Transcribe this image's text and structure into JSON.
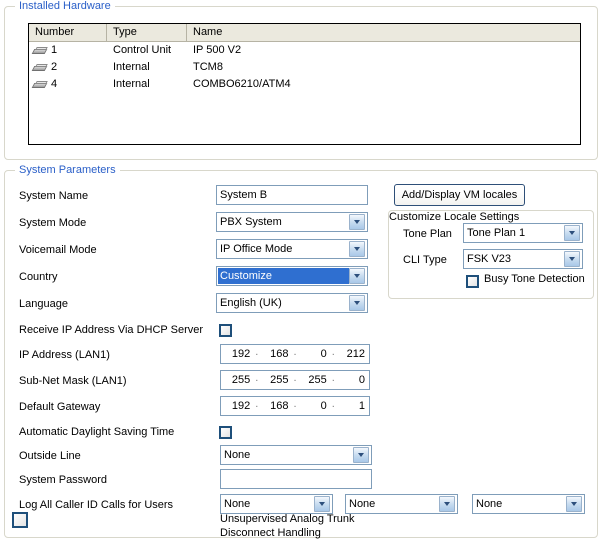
{
  "hardware": {
    "group_title": "Installed Hardware",
    "columns": [
      "Number",
      "Type",
      "Name"
    ],
    "rows": [
      {
        "number": "1",
        "type": "Control Unit",
        "name": "IP 500 V2",
        "icon": "hardware-module-icon"
      },
      {
        "number": "2",
        "type": "Internal",
        "name": "TCM8",
        "icon": "hardware-module-icon"
      },
      {
        "number": "4",
        "type": "Internal",
        "name": "COMBO6210/ATM4",
        "icon": "hardware-module-icon"
      }
    ]
  },
  "params": {
    "group_title": "System Parameters",
    "system_name": {
      "label": "System Name",
      "value": "System B"
    },
    "system_mode": {
      "label": "System Mode",
      "value": "PBX System"
    },
    "voicemail_mode": {
      "label": "Voicemail Mode",
      "value": "IP Office Mode"
    },
    "country": {
      "label": "Country",
      "value": "Customize"
    },
    "language": {
      "label": "Language",
      "value": "English (UK)"
    },
    "dhcp": {
      "label": "Receive IP Address Via DHCP Server",
      "checked": false
    },
    "ip_address": {
      "label": "IP Address (LAN1)",
      "octets": [
        "192",
        "168",
        "0",
        "212"
      ]
    },
    "subnet_mask": {
      "label": "Sub-Net Mask (LAN1)",
      "octets": [
        "255",
        "255",
        "255",
        "0"
      ]
    },
    "default_gateway": {
      "label": "Default Gateway",
      "octets": [
        "192",
        "168",
        "0",
        "1"
      ]
    },
    "dst": {
      "label": "Automatic Daylight Saving Time",
      "checked": false
    },
    "outside_line": {
      "label": "Outside Line",
      "value": "None"
    },
    "system_password": {
      "label": "System Password",
      "value": ""
    },
    "log_caller_id": {
      "label": "Log All Caller ID Calls for Users",
      "values": [
        "None",
        "None",
        "None"
      ]
    },
    "unsupervised": {
      "line1": "Unsupervised Analog Trunk",
      "line2": "Disconnect Handling",
      "checked": false
    }
  },
  "locale": {
    "vm_button": "Add/Display VM locales",
    "group_title": "Customize Locale Settings",
    "tone_plan": {
      "label": "Tone Plan",
      "value": "Tone Plan 1"
    },
    "cli_type": {
      "label": "CLI Type",
      "value": "FSK V23"
    },
    "busy_tone": {
      "label": "Busy Tone Detection",
      "checked": false
    }
  },
  "colors": {
    "group_title": "#2a5fc8",
    "selection": "#2f6fd0",
    "input_border": "#7f9db9",
    "checkbox_border": "#1e4f7a",
    "table_header_bg": "#ebe9de"
  }
}
